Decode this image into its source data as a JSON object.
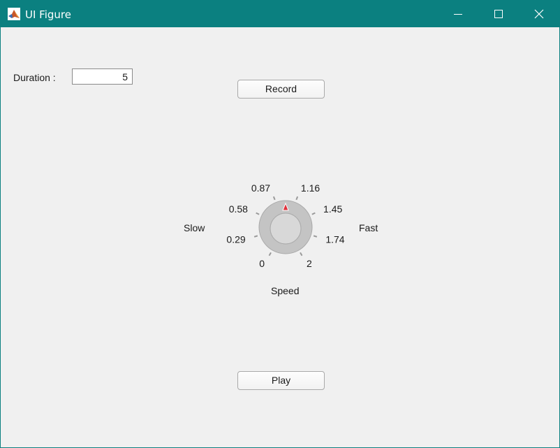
{
  "window": {
    "title": "UI Figure",
    "controls": {
      "minimize": "minimize-icon",
      "maximize": "maximize-icon",
      "close": "close-icon"
    }
  },
  "duration": {
    "label": "Duration :",
    "value": "5"
  },
  "buttons": {
    "record": "Record",
    "play": "Play"
  },
  "knob": {
    "label": "Speed",
    "left_label": "Slow",
    "right_label": "Fast",
    "value": 1,
    "min": 0,
    "max": 2,
    "tick_labels": [
      "0",
      "0.29",
      "0.58",
      "0.87",
      "1.16",
      "1.45",
      "1.74",
      "2"
    ]
  },
  "colors": {
    "titlebar": "#0b8080",
    "background": "#f0f0f0",
    "indicator": "#e0323c"
  }
}
